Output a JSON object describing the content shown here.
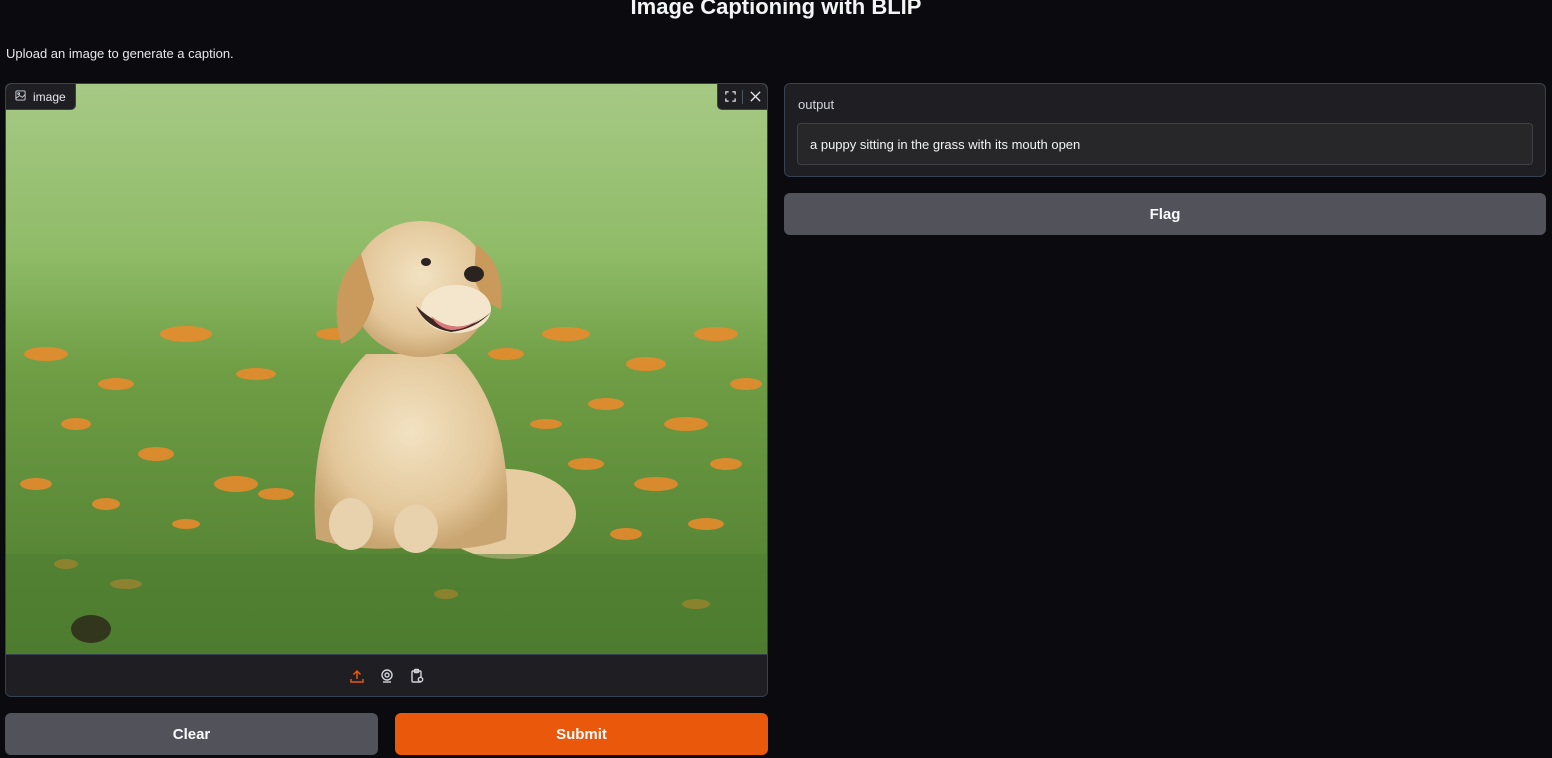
{
  "page": {
    "title": "Image Captioning with BLIP",
    "subtitle": "Upload an image to generate a caption."
  },
  "image_input": {
    "label": "image",
    "label_icon": "image-icon",
    "actions": [
      "fullscreen-icon",
      "close-icon"
    ],
    "sources": [
      "upload-icon",
      "webcam-icon",
      "clipboard-icon"
    ]
  },
  "output": {
    "label": "output",
    "value": "a puppy sitting in the grass with its mouth open"
  },
  "buttons": {
    "clear": "Clear",
    "submit": "Submit",
    "flag": "Flag"
  },
  "colors": {
    "background": "#0b0b0f",
    "panel": "#1f1f23",
    "primary": "#ea580c",
    "secondary": "#52525b"
  }
}
